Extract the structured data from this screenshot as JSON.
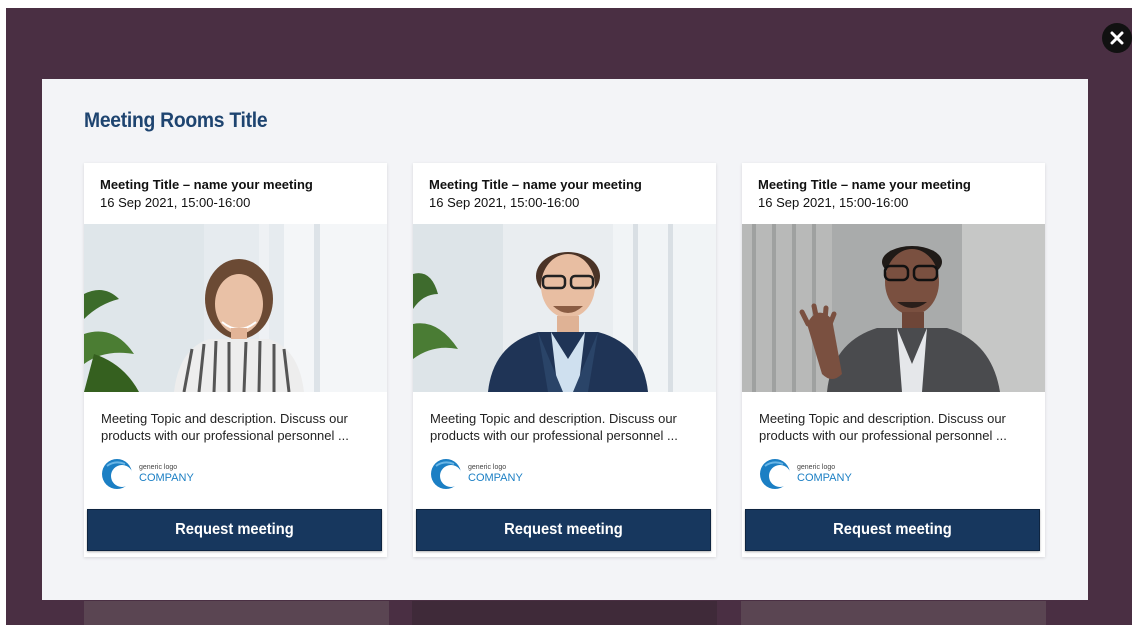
{
  "modal": {
    "title": "Meeting Rooms Title"
  },
  "close_icon": "close-icon",
  "cards": [
    {
      "title": "Meeting Title – name your meeting",
      "datetime": "16 Sep 2021, 15:00-16:00",
      "photo": "woman-in-striped-blouse-photo",
      "description": "Meeting Topic and description. Discuss our products with our professional personnel ...",
      "logo_small": "generic logo",
      "logo_company": "COMPANY",
      "button_label": "Request meeting"
    },
    {
      "title": "Meeting Title – name your meeting",
      "datetime": "16 Sep 2021, 15:00-16:00",
      "photo": "man-in-navy-suit-photo",
      "description": "Meeting Topic and description. Discuss our products with our professional personnel ...",
      "logo_small": "generic logo",
      "logo_company": "COMPANY",
      "button_label": "Request meeting"
    },
    {
      "title": "Meeting Title – name your meeting",
      "datetime": "16 Sep 2021, 15:00-16:00",
      "photo": "man-in-grey-blazer-photo",
      "description": "Meeting Topic and description. Discuss our products with our professional personnel ...",
      "logo_small": "generic logo",
      "logo_company": "COMPANY",
      "button_label": "Request meeting"
    }
  ],
  "colors": {
    "backdrop": "#4a2f43",
    "modal_bg": "#f3f4f7",
    "title": "#1e4470",
    "button": "#17375e",
    "logo_blue": "#1b7fc4"
  }
}
